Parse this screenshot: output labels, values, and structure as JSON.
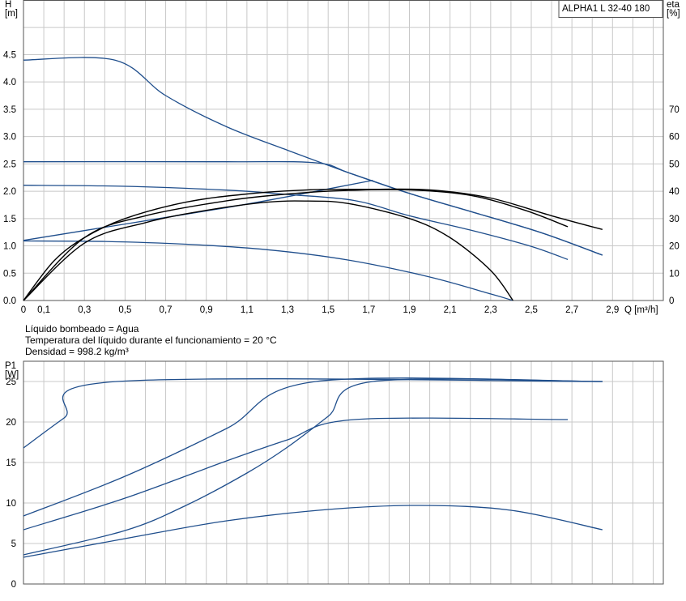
{
  "chart_data": [
    {
      "type": "line",
      "title": "ALPHA1 L 32-40  180",
      "xlabel": "Q [m³/h]",
      "ylabel": "H\n[m]",
      "y2label": "eta\n[%]",
      "xlim": [
        0,
        3.15
      ],
      "ylim": [
        0,
        5.5
      ],
      "y2lim": [
        0,
        110
      ],
      "grid": true,
      "x_tick_values": [
        0,
        0.1,
        0.3,
        0.5,
        0.7,
        0.9,
        1.1,
        1.3,
        1.5,
        1.7,
        1.9,
        2.1,
        2.3,
        2.5,
        2.7,
        2.9
      ],
      "x_tick_labels": [
        "0",
        "0,1",
        "0,3",
        "0,5",
        "0,7",
        "0,9",
        "1,1",
        "1,3",
        "1,5",
        "1,7",
        "1,9",
        "2,1",
        "2,3",
        "2,5",
        "2,7",
        "2,9"
      ],
      "y_ticks": [
        "0.0",
        "0.5",
        "1.0",
        "1.5",
        "2.0",
        "2.5",
        "3.0",
        "3.5",
        "4.0",
        "4.5"
      ],
      "y2_ticks": [
        "0",
        "10",
        "20",
        "30",
        "40",
        "50",
        "60",
        "70"
      ],
      "series": [
        {
          "axis": "H",
          "color": "#1f4e8c",
          "x": [
            0,
            0.45,
            0.7,
            1.0,
            1.3,
            1.6,
            1.9,
            2.2,
            2.55,
            2.85
          ],
          "y": [
            4.4,
            4.4,
            3.75,
            3.18,
            2.75,
            2.34,
            1.96,
            1.63,
            1.24,
            0.83
          ]
        },
        {
          "axis": "H",
          "color": "#1f4e8c",
          "x": [
            0,
            1.0,
            1.44,
            1.6,
            1.9,
            2.2,
            2.55,
            2.85
          ],
          "y": [
            2.54,
            2.54,
            2.52,
            2.34,
            1.96,
            1.63,
            1.24,
            0.83
          ]
        },
        {
          "axis": "H",
          "color": "#1f4e8c",
          "x": [
            0,
            0.5,
            1.0,
            1.3,
            1.63,
            1.9,
            2.2,
            2.5,
            2.68
          ],
          "y": [
            2.11,
            2.09,
            2.02,
            1.94,
            1.83,
            1.55,
            1.29,
            0.99,
            0.75
          ]
        },
        {
          "axis": "H",
          "color": "#1f4e8c",
          "x": [
            0,
            0.4,
            0.8,
            1.2,
            1.6,
            2.0,
            2.3,
            2.41
          ],
          "y": [
            1.09,
            1.08,
            1.03,
            0.93,
            0.74,
            0.43,
            0.12,
            0.0
          ]
        },
        {
          "axis": "eta",
          "color": "#1f4e8c",
          "x": [
            0,
            0.5,
            1.0,
            1.3,
            1.72
          ],
          "y": [
            22,
            28,
            34,
            38,
            44
          ]
        },
        {
          "axis": "eta",
          "color": "#000000",
          "x": [
            0,
            0.15,
            0.3,
            0.5,
            0.8,
            1.1,
            1.4,
            1.7,
            2.0,
            2.3,
            2.6,
            2.85
          ],
          "y": [
            0,
            14.5,
            23,
            30,
            36,
            39,
            40.5,
            40.7,
            40.5,
            37.5,
            31,
            26
          ]
        },
        {
          "axis": "eta",
          "color": "#000000",
          "x": [
            0,
            0.3,
            0.6,
            1.0,
            1.3,
            1.6,
            1.9,
            2.2,
            2.47,
            2.68
          ],
          "y": [
            0,
            23,
            31,
            36.5,
            39,
            40.3,
            40.5,
            38.5,
            33,
            27
          ]
        },
        {
          "axis": "eta",
          "color": "#000000",
          "x": [
            0,
            0.3,
            0.6,
            0.9,
            1.2,
            1.4,
            1.6,
            1.9,
            2.1,
            2.3,
            2.41
          ],
          "y": [
            0,
            21,
            28.5,
            33,
            36,
            36.4,
            35.5,
            30,
            23,
            11,
            0
          ]
        }
      ]
    },
    {
      "type": "line",
      "xlabel": "",
      "ylabel": "P1\n[W]",
      "xlim": [
        0,
        3.15
      ],
      "ylim": [
        0,
        27.5
      ],
      "grid": true,
      "y_ticks": [
        "0",
        "5",
        "10",
        "15",
        "20",
        "25"
      ],
      "series": [
        {
          "color": "#1f4e8c",
          "x": [
            0,
            0.2,
            0.46,
            2.85
          ],
          "y": [
            16.8,
            20.5,
            25,
            25
          ]
        },
        {
          "color": "#1f4e8c",
          "x": [
            0,
            0.5,
            1.0,
            1.44,
            2.85
          ],
          "y": [
            8.4,
            13.3,
            19.2,
            25,
            25
          ]
        },
        {
          "color": "#1f4e8c",
          "x": [
            0,
            0.5,
            1.0,
            1.3,
            1.63,
            2.68
          ],
          "y": [
            6.7,
            10.6,
            15.2,
            17.8,
            20.3,
            20.3
          ]
        },
        {
          "color": "#1f4e8c",
          "x": [
            0,
            0.5,
            0.8,
            1.1,
            1.3,
            1.5,
            1.72,
            2.85
          ],
          "y": [
            3.6,
            6.6,
            9.7,
            13.7,
            16.9,
            20.7,
            25,
            25
          ]
        },
        {
          "color": "#1f4e8c",
          "x": [
            0,
            0.5,
            1.0,
            1.5,
            1.95,
            2.4,
            2.85
          ],
          "y": [
            3.3,
            5.6,
            7.8,
            9.2,
            9.7,
            9.1,
            6.7
          ]
        }
      ]
    }
  ],
  "notes": [
    "Líquido bombeado = Agua",
    "Temperatura del líquido durante el funcionamiento = 20 °C",
    "Densidad = 998.2 kg/m³"
  ]
}
